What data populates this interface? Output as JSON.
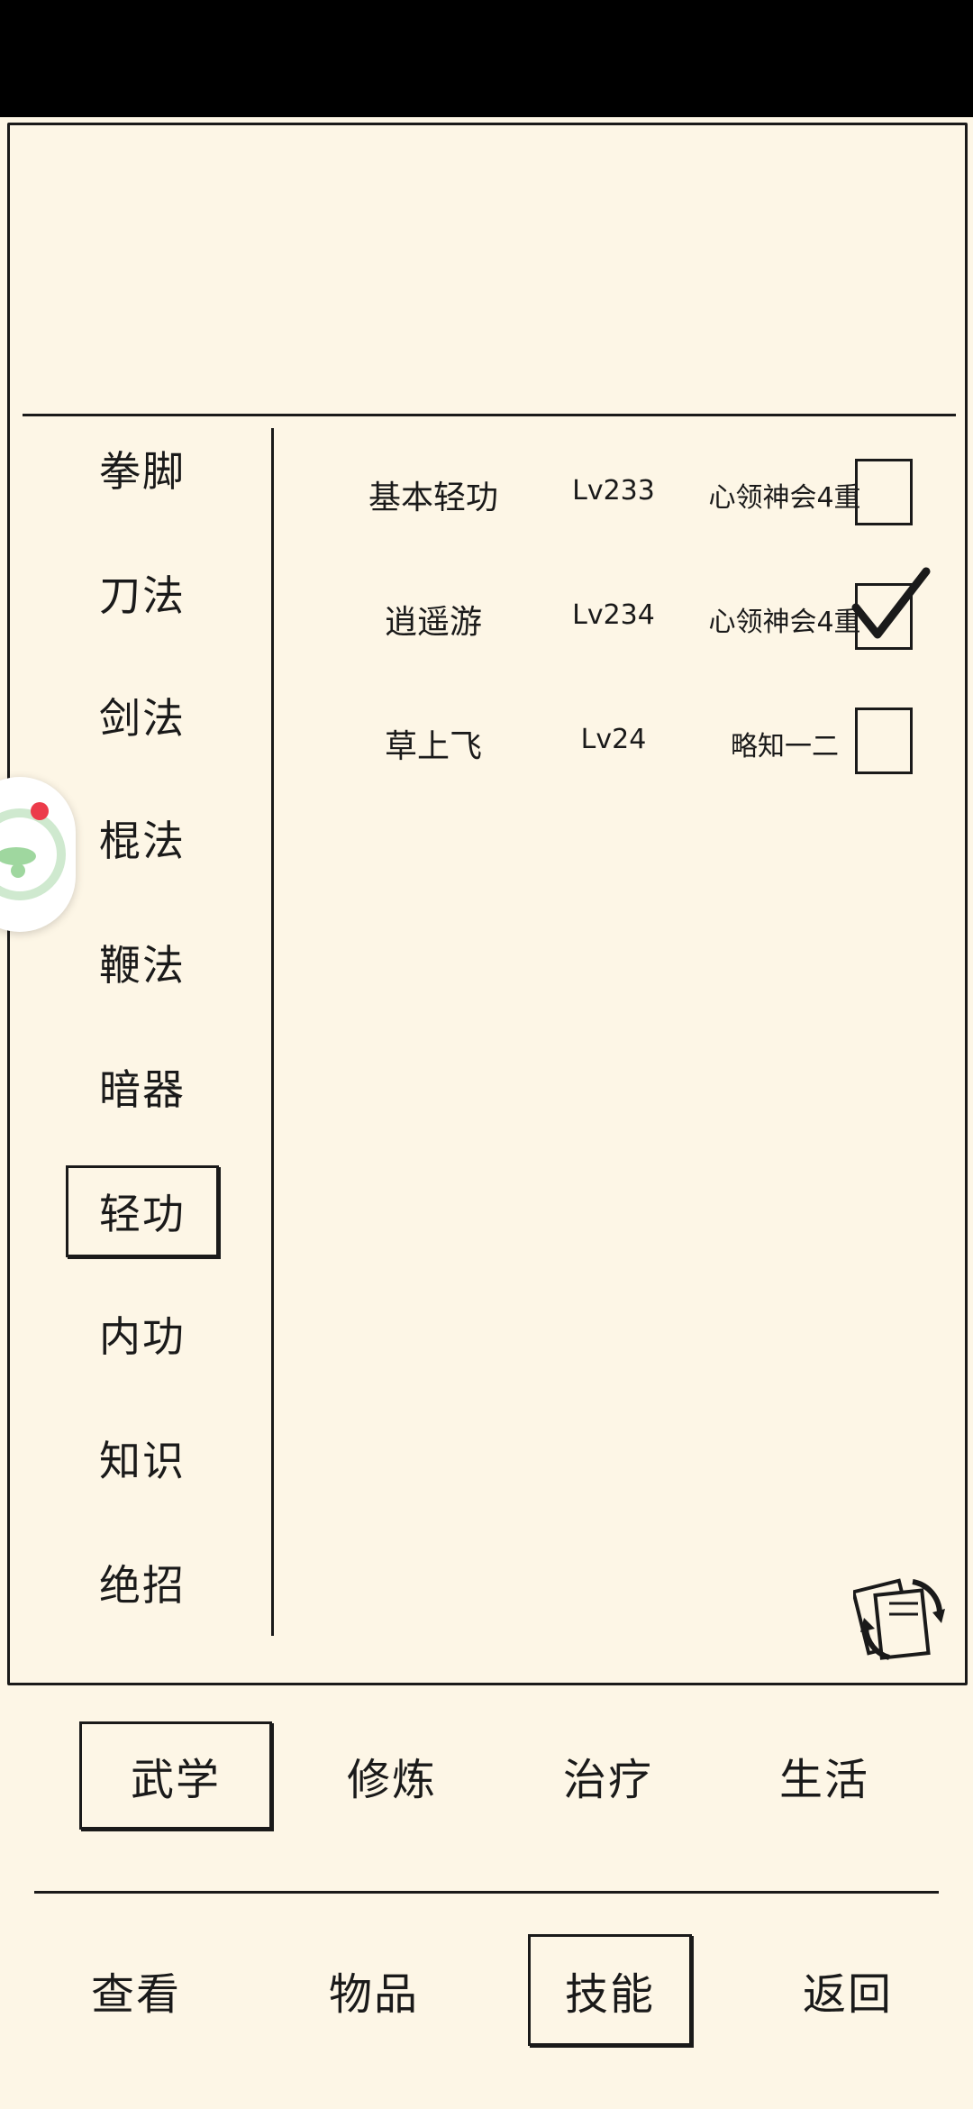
{
  "categories": [
    {
      "label": "拳脚"
    },
    {
      "label": "刀法"
    },
    {
      "label": "剑法"
    },
    {
      "label": "棍法"
    },
    {
      "label": "鞭法"
    },
    {
      "label": "暗器"
    },
    {
      "label": "轻功",
      "selected": true
    },
    {
      "label": "内功"
    },
    {
      "label": "知识"
    },
    {
      "label": "绝招"
    }
  ],
  "skills": [
    {
      "name": "基本轻功",
      "level": "Lv233",
      "rank": "心领神会4重",
      "checked": false
    },
    {
      "name": "逍遥游",
      "level": "Lv234",
      "rank": "心领神会4重",
      "checked": true
    },
    {
      "name": "草上飞",
      "level": "Lv24",
      "rank": "略知一二",
      "checked": false
    }
  ],
  "sub_tabs": [
    {
      "label": "武学",
      "selected": true
    },
    {
      "label": "修炼"
    },
    {
      "label": "治疗"
    },
    {
      "label": "生活"
    }
  ],
  "bottom_nav": [
    {
      "label": "查看"
    },
    {
      "label": "物品"
    },
    {
      "label": "技能",
      "selected": true
    },
    {
      "label": "返回"
    }
  ],
  "icons": {
    "refresh": "refresh-cards-icon",
    "checkmark": "checkmark-icon",
    "floating": "floating-assistant-icon"
  },
  "colors": {
    "background": "#fdf6e6",
    "ink": "#1a1a1a",
    "notification_dot": "#ec3b4a"
  }
}
